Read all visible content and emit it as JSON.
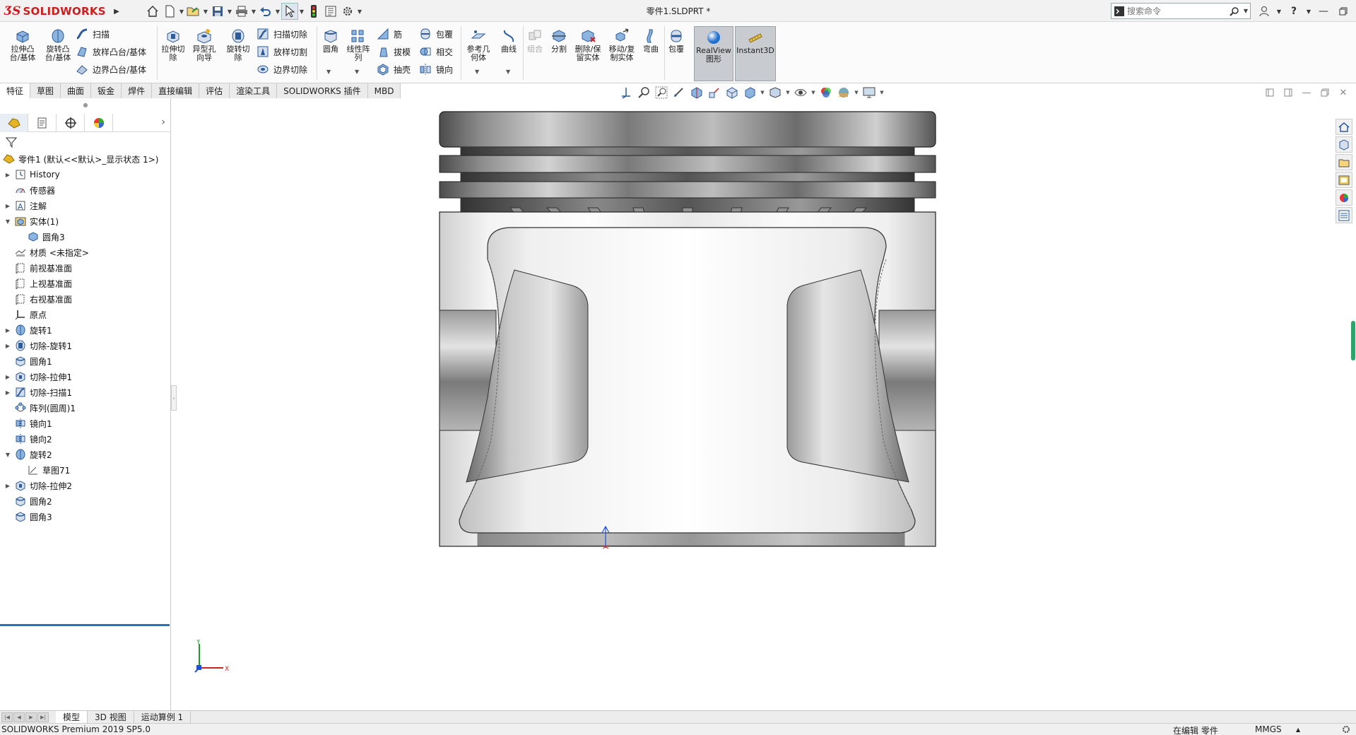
{
  "app": {
    "brand": "SOLIDWORKS",
    "document_title": "零件1.SLDPRT *",
    "search_placeholder": "搜索命令"
  },
  "ribbon": {
    "extrude_boss": "拉伸凸\n台/基体",
    "revolve_boss": "旋转凸\n台/基体",
    "sweep": "扫描",
    "loft": "放样凸台/基体",
    "boundary_boss": "边界凸台/基体",
    "extrude_cut": "拉伸切\n除",
    "hole_wizard": "异型孔\n向导",
    "revolve_cut": "旋转切\n除",
    "sweep_cut": "扫描切除",
    "loft_cut": "放样切割",
    "boundary_cut": "边界切除",
    "fillet": "圆角",
    "linear_pattern": "线性阵\n列",
    "rib": "筋",
    "draft": "拔模",
    "shell": "抽壳",
    "wrap": "包覆",
    "intersect": "相交",
    "mirror": "镜向",
    "ref_geometry": "参考几\n何体",
    "curves": "曲线",
    "combine": "组合",
    "split": "分割",
    "delete_body": "删除/保\n留实体",
    "move_copy": "移动/复\n制实体",
    "flex": "弯曲",
    "wrap2": "包覆",
    "realview": "RealView\n图形",
    "instant3d": "Instant3D"
  },
  "command_tabs": [
    "特征",
    "草图",
    "曲面",
    "钣金",
    "焊件",
    "直接编辑",
    "评估",
    "渲染工具",
    "SOLIDWORKS 插件",
    "MBD"
  ],
  "feature_manager": {
    "root": "零件1 (默认<<默认>_显示状态 1>)",
    "items": [
      {
        "label": "History",
        "icon": "history-icon",
        "indent": 1,
        "expand": "▶"
      },
      {
        "label": "传感器",
        "icon": "sensor-icon",
        "indent": 1,
        "expand": ""
      },
      {
        "label": "注解",
        "icon": "annotation-icon",
        "indent": 1,
        "expand": "▶"
      },
      {
        "label": "实体(1)",
        "icon": "solid-bodies-icon",
        "indent": 1,
        "expand": "▼"
      },
      {
        "label": "圆角3",
        "icon": "body-icon",
        "indent": 2,
        "expand": ""
      },
      {
        "label": "材质 <未指定>",
        "icon": "material-icon",
        "indent": 1,
        "expand": ""
      },
      {
        "label": "前视基准面",
        "icon": "plane-icon",
        "indent": 1,
        "expand": ""
      },
      {
        "label": "上视基准面",
        "icon": "plane-icon",
        "indent": 1,
        "expand": ""
      },
      {
        "label": "右视基准面",
        "icon": "plane-icon",
        "indent": 1,
        "expand": ""
      },
      {
        "label": "原点",
        "icon": "origin-icon",
        "indent": 1,
        "expand": ""
      },
      {
        "label": "旋转1",
        "icon": "revolve-icon",
        "indent": 1,
        "expand": "▶"
      },
      {
        "label": "切除-旋转1",
        "icon": "cut-revolve-icon",
        "indent": 1,
        "expand": "▶"
      },
      {
        "label": "圆角1",
        "icon": "fillet-icon",
        "indent": 1,
        "expand": ""
      },
      {
        "label": "切除-拉伸1",
        "icon": "cut-extrude-icon",
        "indent": 1,
        "expand": "▶"
      },
      {
        "label": "切除-扫描1",
        "icon": "cut-sweep-icon",
        "indent": 1,
        "expand": "▶"
      },
      {
        "label": "阵列(圆周)1",
        "icon": "circular-pattern-icon",
        "indent": 1,
        "expand": ""
      },
      {
        "label": "镜向1",
        "icon": "mirror-icon",
        "indent": 1,
        "expand": ""
      },
      {
        "label": "镜向2",
        "icon": "mirror-icon",
        "indent": 1,
        "expand": ""
      },
      {
        "label": "旋转2",
        "icon": "revolve-icon",
        "indent": 1,
        "expand": "▼"
      },
      {
        "label": "草图71",
        "icon": "sketch-icon",
        "indent": 2,
        "expand": ""
      },
      {
        "label": "切除-拉伸2",
        "icon": "cut-extrude-icon",
        "indent": 1,
        "expand": "▶"
      },
      {
        "label": "圆角2",
        "icon": "fillet-icon",
        "indent": 1,
        "expand": ""
      },
      {
        "label": "圆角3",
        "icon": "fillet-icon",
        "indent": 1,
        "expand": ""
      }
    ]
  },
  "bottom_tabs": [
    "模型",
    "3D 视图",
    "运动算例 1"
  ],
  "status": {
    "product": "SOLIDWORKS Premium 2019 SP5.0",
    "mode": "在编辑 零件",
    "units": "MMGS"
  },
  "triad": {
    "x": "X",
    "y": "Y"
  },
  "colors": {
    "brand_red": "#cc1e1e",
    "selection_blue": "#2d74b6",
    "scroll_green": "#2aa56b"
  }
}
